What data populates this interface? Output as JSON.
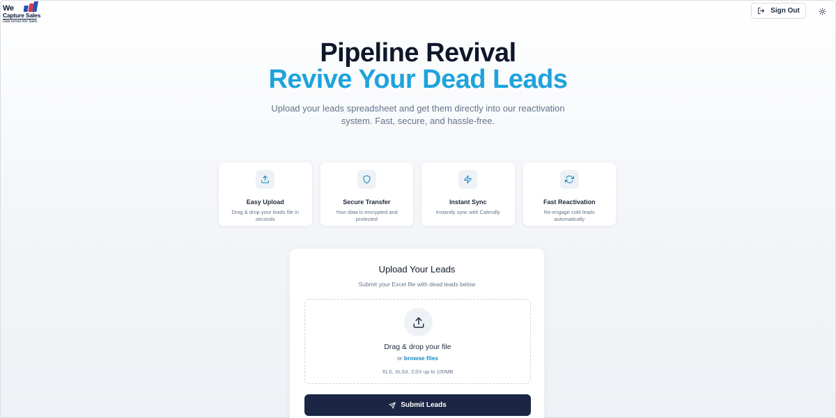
{
  "brand": {
    "logo_word": "We",
    "logo_name": "Capture Sales",
    "logo_tagline": "Data turned into Sales"
  },
  "header": {
    "signout_label": "Sign Out",
    "signout_icon": "log-out-icon",
    "theme_icon": "sun-icon"
  },
  "hero": {
    "title": "Pipeline Revival",
    "subtitle": "Revive Your Dead Leads",
    "description": "Upload your leads spreadsheet and get them directly into our reactivation system. Fast, secure, and hassle-free."
  },
  "features": [
    {
      "icon": "upload-icon",
      "title": "Easy Upload",
      "desc": "Drag & drop your leads file in seconds"
    },
    {
      "icon": "shield-icon",
      "title": "Secure Transfer",
      "desc": "Your data is encrypted and protected"
    },
    {
      "icon": "lightning-icon",
      "title": "Instant Sync",
      "desc": "Instantly sync with Calendly"
    },
    {
      "icon": "refresh-icon",
      "title": "Fast Reactivation",
      "desc": "Re-engage cold leads automatically"
    }
  ],
  "upload": {
    "title": "Upload Your Leads",
    "subtitle": "Submit your Excel file with dead leads below",
    "drop_title": "Drag & drop your file",
    "drop_or": "or",
    "browse_label": "browse files",
    "formats": "XLS, XLSX, CSV up to 100MB",
    "submit_label": "Submit Leads"
  },
  "colors": {
    "accent": "#1ea3dc",
    "primary_button": "#1b2544",
    "link": "#1689c4"
  }
}
